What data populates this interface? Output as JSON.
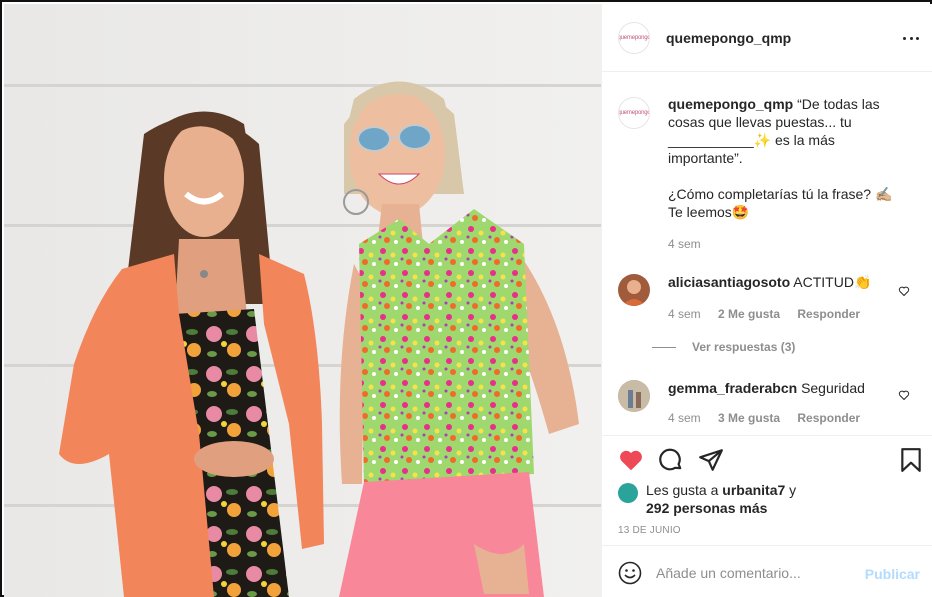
{
  "post": {
    "username": "quemepongo_qmp",
    "avatar_text": "quemepongo",
    "photo_alt": ""
  },
  "caption": {
    "username": "quemepongo_qmp",
    "line1": "“De todas las cosas que llevas puestas... tu ___________✨ es la más importante”.",
    "line2": "¿Cómo completarías tú la frase? ✍🏼 Te leemos🤩",
    "time": "4 sem"
  },
  "comments": [
    {
      "username": "aliciasantiagosoto",
      "text": "ACTITUD👏",
      "time": "4 sem",
      "likes": "2 Me gusta",
      "reply": "Responder",
      "avatar_color": "#a05a3c"
    },
    {
      "username": "gemma_fraderabcn",
      "text": "Seguridad",
      "time": "4 sem",
      "likes": "3 Me gusta",
      "reply": "Responder",
      "avatar_color": "#b9a58c"
    }
  ],
  "view_replies": "Ver respuestas (3)",
  "likes": {
    "prefix": "Les gusta a ",
    "user": "urbanita7",
    "middle": " y",
    "count": "292 personas más"
  },
  "date": "13 DE JUNIO",
  "add_comment": {
    "placeholder": "Añade un comentario...",
    "publish": "Publicar"
  },
  "icons": {
    "more": "more-options-icon",
    "like": "heart-filled-icon",
    "comment": "comment-bubble-icon",
    "share": "paper-plane-icon",
    "save": "bookmark-icon",
    "emoji": "emoji-smiley-icon"
  },
  "colors": {
    "like_red": "#ed4956",
    "muted": "#8e8e8e",
    "publish_disabled": "#b3dbff"
  }
}
